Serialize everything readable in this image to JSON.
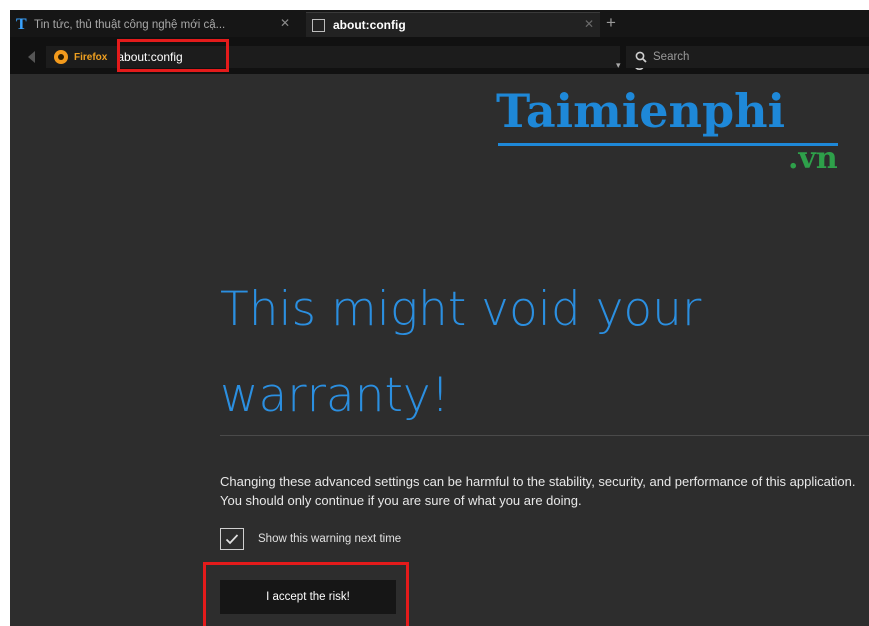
{
  "tabs": [
    {
      "title": "Tin tức, thủ thuật công nghệ mới cậ...",
      "close": "✕"
    },
    {
      "title": "about:config",
      "close": "✕"
    }
  ],
  "newtab_label": "+",
  "navbar": {
    "identity_label": "Firefox",
    "url": "about:config",
    "dropdown": "▾",
    "reload": "C",
    "search_placeholder": "Search"
  },
  "watermark": {
    "brand": "Taimienphi",
    "suffix": ".vn"
  },
  "warning": {
    "title_line1": "This might void your",
    "title_line2": "warranty!",
    "body": "Changing these advanced settings can be harmful to the stability, security, and performance of this application. You should only continue if you are sure of what you are doing.",
    "checkbox_label": "Show this warning next time",
    "checkbox_checked": true,
    "accept_button": "I accept the risk!"
  },
  "colors": {
    "accent_blue": "#2b8fe0",
    "highlight_red": "#e41b1b",
    "watermark_green": "#2ea04a",
    "background": "#2d2d2d"
  }
}
